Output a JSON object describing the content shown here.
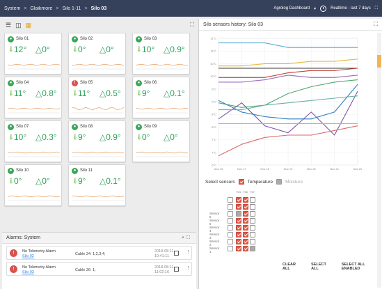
{
  "topbar": {
    "breadcrumbs": [
      "System",
      "Glaikmore",
      "Silo 1-11",
      "Silo 03"
    ],
    "separator": ">",
    "dashboard_label": "Agrolog Dashboard",
    "dropdown_caret": "▾",
    "realtime_label": "Realtime - last 7 days",
    "expand_glyph": "⛶"
  },
  "view_toggle": [
    "list-view-icon",
    "card-view-icon",
    "grid-view-icon"
  ],
  "silos": [
    {
      "name": "Silo 01",
      "temp": "12°",
      "delta": "△0°",
      "status": "ok"
    },
    {
      "name": "Silo 02",
      "temp": "0°",
      "delta": "△0°",
      "status": "ok"
    },
    {
      "name": "Silo 03",
      "temp": "10°",
      "delta": "△0.9°",
      "status": "ok"
    },
    {
      "name": "Silo 04",
      "temp": "11°",
      "delta": "△0.8°",
      "status": "ok"
    },
    {
      "name": "Silo 05",
      "temp": "11°",
      "delta": "△0.5°",
      "status": "alarm"
    },
    {
      "name": "Silo 06",
      "temp": "9°",
      "delta": "△0.1°",
      "status": "ok"
    },
    {
      "name": "Silo 07",
      "temp": "10°",
      "delta": "△0.3°",
      "status": "ok"
    },
    {
      "name": "Silo 08",
      "temp": "9°",
      "delta": "△0.9°",
      "status": "ok"
    },
    {
      "name": "Silo 09",
      "temp": "0°",
      "delta": "△0°",
      "status": "ok"
    },
    {
      "name": "Silo 10",
      "temp": "0°",
      "delta": "△0°",
      "status": "ok"
    },
    {
      "name": "Silo 11",
      "temp": "9°",
      "delta": "△0.1°",
      "status": "ok"
    }
  ],
  "alarms": {
    "title": "Alarms: System",
    "rows": [
      {
        "type": "No Telemetry Alarm",
        "silo": "Silo 02",
        "cable": "Cable 34: 1,2,3,4;",
        "date": "2018-08-11",
        "time": "10:41:11"
      },
      {
        "type": "No Telemetry Alarm",
        "silo": "Silo 03",
        "cable": "Cable 36: 1;",
        "date": "2018-08-11",
        "time": "11:02:16"
      }
    ]
  },
  "history": {
    "title": "Silo sensors history: Silo 03",
    "select_label": "Select sensors",
    "temperature_label": "Temperature",
    "moisture_label": "Moisture",
    "col_headers": [
      "T04",
      "T06",
      "T07"
    ],
    "sensor_labels": [
      "Sensor 6",
      "Sensor 5",
      "Sensor 4",
      "Sensor 3",
      "Sensor 2",
      "Sensor 1"
    ],
    "buttons": {
      "clear": "CLEAR ALL",
      "select": "SELECT ALL",
      "select_enabled": "SELECT ALL ENABLED"
    }
  },
  "chart_data": {
    "type": "line",
    "title": "",
    "xlabel": "",
    "ylabel": "",
    "x": [
      "Nov 16",
      "Nov 17",
      "Nov 18",
      "Nov 19",
      "Nov 20",
      "Nov 21",
      "Nov 22"
    ],
    "y_ticks": [
      "11°C",
      "11°C",
      "10°C",
      "10°C",
      "9°C",
      "9°C",
      "8°C",
      "8°C",
      "7°C",
      "7°C",
      "6°C"
    ],
    "ylim": [
      6,
      11.5
    ],
    "grid": true,
    "series": [
      {
        "color": "#5aa9d6",
        "values": [
          11.3,
          11.3,
          11.3,
          11.1,
          11.1,
          11.1,
          11.1
        ]
      },
      {
        "color": "#e2b93b",
        "values": [
          10.3,
          10.3,
          10.4,
          10.4,
          10.5,
          10.5,
          10.6
        ]
      },
      {
        "color": "#3a3a3a",
        "values": [
          10.2,
          10.2,
          10.2,
          10.2,
          10.2,
          10.2,
          10.2
        ]
      },
      {
        "color": "#9b6fb8",
        "values": [
          9.6,
          9.6,
          9.7,
          9.9,
          9.8,
          9.8,
          9.9
        ]
      },
      {
        "color": "#c2443c",
        "values": [
          9.8,
          9.8,
          9.8,
          10.0,
          10.1,
          10.1,
          10.2
        ]
      },
      {
        "color": "#4fa96a",
        "values": [
          8.7,
          8.5,
          8.6,
          9.1,
          9.4,
          9.6,
          9.7
        ]
      },
      {
        "color": "#2e7fbf",
        "values": [
          8.8,
          8.3,
          8.1,
          8.0,
          8.0,
          8.3,
          9.5
        ]
      },
      {
        "color": "#7e57a8",
        "values": [
          8.0,
          8.7,
          7.7,
          7.4,
          8.3,
          7.3,
          9.2
        ]
      },
      {
        "color": "#6ab0a8",
        "values": [
          8.4,
          8.4,
          8.6,
          8.7,
          8.8,
          8.9,
          9.0
        ]
      },
      {
        "color": "#e8a96a",
        "values": [
          7.8,
          7.8,
          7.8,
          7.8,
          7.8,
          7.8,
          7.8
        ]
      },
      {
        "color": "#d96a6a",
        "values": [
          6.4,
          6.9,
          7.2,
          7.3,
          7.3,
          7.5,
          7.7
        ]
      }
    ]
  }
}
